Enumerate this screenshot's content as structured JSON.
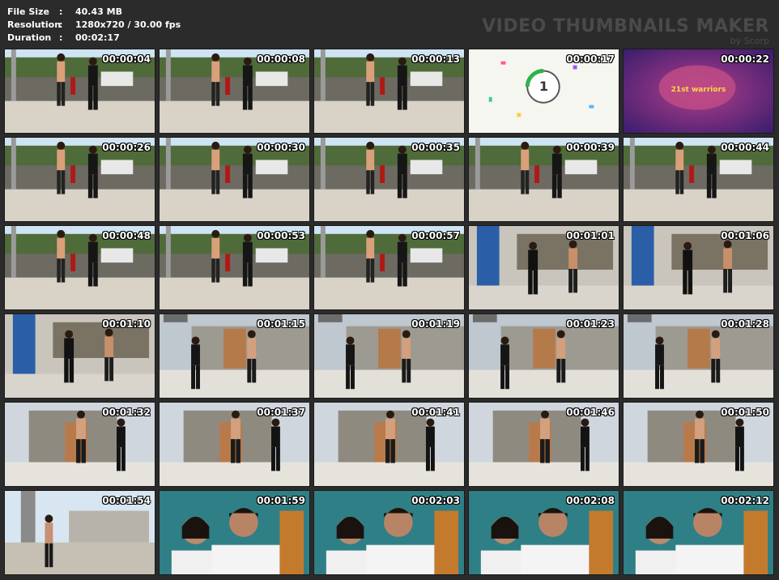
{
  "meta": {
    "file_size_label": "File Size",
    "file_size_value": "40.43 MB",
    "resolution_label": "Resolution",
    "resolution_value": "1280x720 / 30.00 fps",
    "duration_label": "Duration",
    "duration_value": "00:02:17",
    "separator": ":"
  },
  "brand": {
    "title": "VIDEO THUMBNAILS MAKER",
    "subtitle": "by Scorp"
  },
  "frames": [
    {
      "time": "00:00:04",
      "scene": "yard"
    },
    {
      "time": "00:00:08",
      "scene": "yard"
    },
    {
      "time": "00:00:13",
      "scene": "yard"
    },
    {
      "time": "00:00:17",
      "scene": "countdown",
      "text": "1"
    },
    {
      "time": "00:00:22",
      "scene": "title",
      "text": "21st warriors"
    },
    {
      "time": "00:00:26",
      "scene": "yard"
    },
    {
      "time": "00:00:30",
      "scene": "yard"
    },
    {
      "time": "00:00:35",
      "scene": "yard"
    },
    {
      "time": "00:00:39",
      "scene": "yard"
    },
    {
      "time": "00:00:44",
      "scene": "yard"
    },
    {
      "time": "00:00:48",
      "scene": "yard2"
    },
    {
      "time": "00:00:53",
      "scene": "yard2"
    },
    {
      "time": "00:00:57",
      "scene": "yard2"
    },
    {
      "time": "00:01:01",
      "scene": "blue"
    },
    {
      "time": "00:01:06",
      "scene": "blue"
    },
    {
      "time": "00:01:10",
      "scene": "blue"
    },
    {
      "time": "00:01:15",
      "scene": "wall"
    },
    {
      "time": "00:01:19",
      "scene": "wall"
    },
    {
      "time": "00:01:23",
      "scene": "wall"
    },
    {
      "time": "00:01:28",
      "scene": "wall"
    },
    {
      "time": "00:01:32",
      "scene": "door"
    },
    {
      "time": "00:01:37",
      "scene": "door"
    },
    {
      "time": "00:01:41",
      "scene": "door"
    },
    {
      "time": "00:01:46",
      "scene": "door"
    },
    {
      "time": "00:01:50",
      "scene": "door"
    },
    {
      "time": "00:01:54",
      "scene": "sky"
    },
    {
      "time": "00:01:59",
      "scene": "selfie"
    },
    {
      "time": "00:02:03",
      "scene": "selfie"
    },
    {
      "time": "00:02:08",
      "scene": "selfie"
    },
    {
      "time": "00:02:12",
      "scene": "selfie"
    }
  ]
}
